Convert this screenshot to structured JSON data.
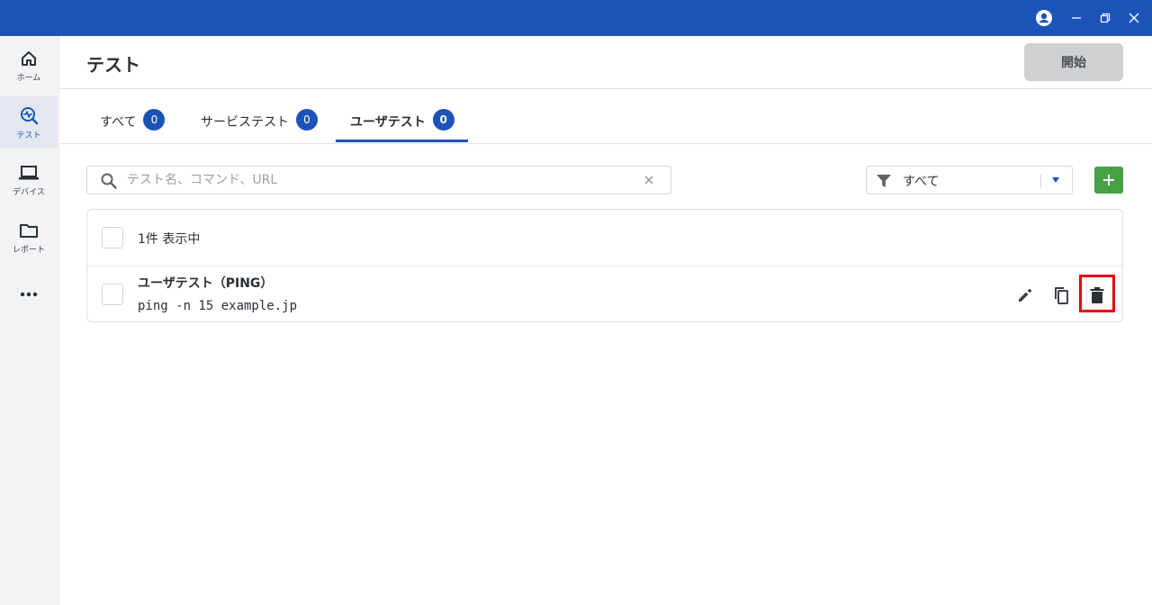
{
  "page": {
    "title": "テスト",
    "start_label": "開始"
  },
  "sidebar": {
    "items": [
      {
        "label": "ホーム",
        "icon": "home-icon"
      },
      {
        "label": "テスト",
        "icon": "test-icon",
        "active": true
      },
      {
        "label": "デバイス",
        "icon": "laptop-icon"
      },
      {
        "label": "レポート",
        "icon": "folder-icon"
      },
      {
        "label": "",
        "icon": "more-icon"
      }
    ]
  },
  "tabs": [
    {
      "label": "すべて",
      "count": "0"
    },
    {
      "label": "サービステスト",
      "count": "0"
    },
    {
      "label": "ユーザテスト",
      "count": "0",
      "active": true
    }
  ],
  "search": {
    "placeholder": "テスト名、コマンド、URL",
    "value": ""
  },
  "filter": {
    "selected": "すべて"
  },
  "list": {
    "count_text": "1件 表示中",
    "rows": [
      {
        "name": "ユーザテスト（PING）",
        "command": "ping -n 15 example.jp"
      }
    ]
  },
  "colors": {
    "brand": "#1c53b8",
    "add_button": "#48a046",
    "highlight": "#e8000b"
  }
}
